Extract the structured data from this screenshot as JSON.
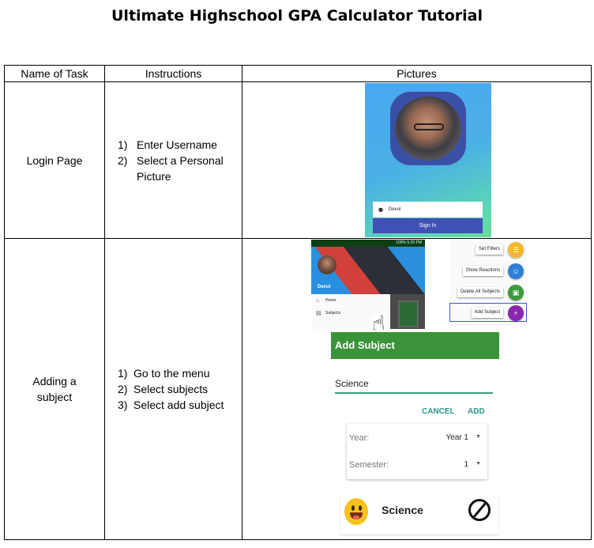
{
  "document": {
    "title": "Ultimate Highschool GPA Calculator Tutorial"
  },
  "table": {
    "headers": [
      "Name of Task",
      "Instructions",
      "Pictures"
    ],
    "rows": [
      {
        "task": "Login Page",
        "steps": [
          {
            "num": "1)",
            "text": "Enter Username"
          },
          {
            "num": "2)",
            "text": "Select a Personal"
          },
          {
            "num": "",
            "text": "Picture"
          }
        ]
      },
      {
        "task_line1": "Adding a",
        "task_line2": "subject",
        "steps": [
          {
            "num": "1)",
            "text": "Go to the menu"
          },
          {
            "num": "2)",
            "text": "Select subjects"
          },
          {
            "num": "3)",
            "text": "Select add subject"
          }
        ]
      }
    ]
  },
  "login_screen": {
    "username_value": "Devul",
    "signin_label": "Sign In",
    "user_icon": "person-icon",
    "colors": {
      "gradient_top": "#4aa8f2",
      "gradient_bottom": "#66dd99",
      "button": "#3f51b5"
    }
  },
  "drawer_screen": {
    "status_text": "100% 5:26 PM",
    "username": "Devul",
    "menu": [
      {
        "icon": "home-icon",
        "label": "Home"
      },
      {
        "icon": "subjects-icon",
        "label": "Subjects"
      }
    ],
    "cursor_icon": "hand-pointer-icon"
  },
  "fab_menu": {
    "items": [
      {
        "label": "Set Filters",
        "color": "#f4b82a",
        "icon": "filter-icon"
      },
      {
        "label": "Show Reactions",
        "color": "#2f7fd8",
        "icon": "smiley-icon"
      },
      {
        "label": "Delete All Subjects",
        "color": "#3c9a3c",
        "icon": "trash-icon"
      },
      {
        "label": "Add Subject",
        "color": "#8a26b0",
        "icon": "plus-icon"
      }
    ]
  },
  "add_subject_dialog": {
    "title": "Add Subject",
    "subject_value": "Science",
    "cancel_label": "CANCEL",
    "add_label": "ADD",
    "year_label": "Year:",
    "year_value": "Year 1",
    "semester_label": "Semester:",
    "semester_value": "1",
    "colors": {
      "header": "#3b9339",
      "accent": "#29998a"
    }
  },
  "subject_card": {
    "name": "Science",
    "emoji_icon": "grinning-emoji-icon",
    "block_icon": "prohibited-icon"
  }
}
